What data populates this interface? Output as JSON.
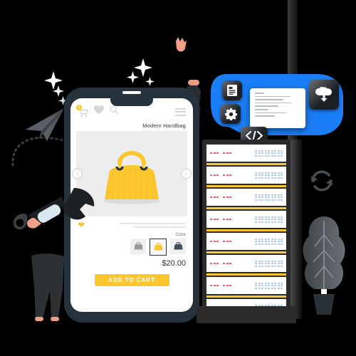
{
  "scene": {
    "background": "#000000",
    "accent_yellow": "#fcc62e",
    "accent_blue": "#1b7ef7",
    "dark_navy": "#26323c"
  },
  "phone": {
    "header": {
      "cart_icon": "shopping-cart-icon",
      "cart_badge_count": "1",
      "wishlist_icon": "heart-icon",
      "search_icon": "search-icon",
      "menu_icon": "hamburger-menu-icon"
    },
    "product": {
      "title": "Modern Handbag",
      "image_alt": "yellow-handbag",
      "prev_label": "‹",
      "next_label": "›",
      "like_icon": "heart-filled-icon",
      "color_label": "Color",
      "swatches": [
        {
          "name": "gray",
          "color": "#9a9a9a",
          "selected": false
        },
        {
          "name": "yellow",
          "color": "#fcc62e",
          "selected": true
        },
        {
          "name": "navy",
          "color": "#3d4e5c",
          "selected": false
        }
      ],
      "price": "$20.00",
      "add_to_cart_label": "ADD TO CART"
    }
  },
  "blob": {
    "tiles": [
      {
        "name": "document-icon",
        "label": "document"
      },
      {
        "name": "gear-icon",
        "label": "settings"
      },
      {
        "name": "cloud-download-icon",
        "label": "cloud download"
      },
      {
        "name": "code-icon",
        "label": "</>"
      }
    ],
    "window": {
      "name": "code-window",
      "line_count": "9"
    }
  },
  "rack": {
    "name": "server-rack",
    "slot_count": "8",
    "slot_indicator_color": "#e8606a",
    "slot_matrix_color": "#b6cce8",
    "divider_color": "#fcc62e"
  },
  "decor": {
    "refresh_icon": "refresh-sync-icon",
    "plant_icon": "potted-plant-icon",
    "paper_plane_icon": "paper-plane-icon",
    "wrench_icon": "wrench-icon",
    "sparkle_icon": "sparkle-star-icon",
    "person_sitting": "person-sitting-on-phone",
    "person_legs": "person-legs-standing",
    "waving_hand": "waving-hand-icon"
  }
}
